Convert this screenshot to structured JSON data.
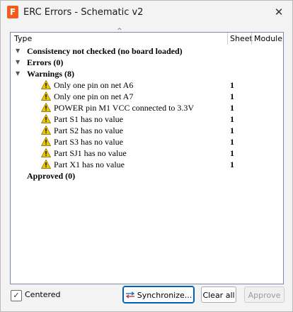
{
  "window": {
    "title": "ERC Errors - Schematic v2"
  },
  "columns": {
    "type": "Type",
    "sheet": "Sheet",
    "module": "Module"
  },
  "groups": {
    "consistency": {
      "label": "Consistency not checked (no board loaded)"
    },
    "errors": {
      "label": "Errors (0)"
    },
    "warnings": {
      "label": "Warnings (8)"
    },
    "approved": {
      "label": "Approved (0)"
    }
  },
  "warnings": [
    {
      "text": "Only one pin on net A6",
      "sheet": "1"
    },
    {
      "text": "Only one pin on net A7",
      "sheet": "1"
    },
    {
      "text": "POWER pin M1 VCC connected to 3.3V",
      "sheet": "1"
    },
    {
      "text": "Part S1 has no value",
      "sheet": "1"
    },
    {
      "text": "Part S2 has no value",
      "sheet": "1"
    },
    {
      "text": "Part S3 has no value",
      "sheet": "1"
    },
    {
      "text": "Part SJ1 has no value",
      "sheet": "1"
    },
    {
      "text": "Part X1 has no value",
      "sheet": "1"
    }
  ],
  "footer": {
    "centered_label": "Centered",
    "centered_checked": true,
    "synchronize_label": "Synchronize...",
    "clear_all_label": "Clear all",
    "approve_label": "Approve"
  },
  "colors": {
    "warning": "#f5c400",
    "accent": "#005fb8",
    "app_icon": "#f25c1e"
  }
}
